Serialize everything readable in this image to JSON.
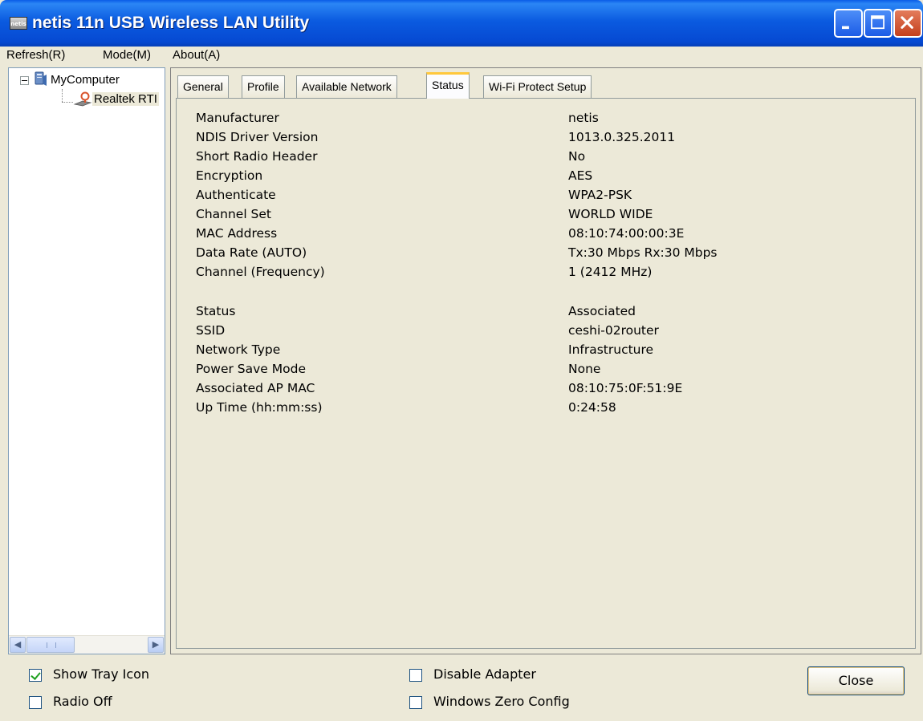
{
  "window": {
    "title": "netis 11n USB Wireless LAN Utility",
    "app_icon": "netis-app-icon",
    "app_icon_text": "netis",
    "controls": [
      "minimize-icon",
      "maximize-icon",
      "close-icon"
    ]
  },
  "menu": {
    "items": [
      {
        "label": "Refresh",
        "mnemonic": "(R)"
      },
      {
        "label": "Mode",
        "mnemonic": "(M)"
      },
      {
        "label": "About",
        "mnemonic": "(A)"
      }
    ]
  },
  "tree": {
    "root": {
      "label": "MyComputer",
      "icon": "computer-icon",
      "expanded": true
    },
    "child": {
      "label": "Realtek RTI",
      "icon": "wireless-adapter-icon",
      "selected": true
    }
  },
  "tabs": [
    {
      "label": "General",
      "active": false
    },
    {
      "label": "Profile",
      "active": false
    },
    {
      "label": "Available Network",
      "active": false
    },
    {
      "label": "Status",
      "active": true
    },
    {
      "label": "Wi-Fi Protect Setup",
      "active": false
    }
  ],
  "status": {
    "adapter_info": [
      {
        "label": "Manufacturer",
        "value": "netis"
      },
      {
        "label": "NDIS Driver Version",
        "value": "1013.0.325.2011"
      },
      {
        "label": "Short Radio Header",
        "value": "No"
      },
      {
        "label": "Encryption",
        "value": "AES"
      },
      {
        "label": "Authenticate",
        "value": "WPA2-PSK"
      },
      {
        "label": "Channel Set",
        "value": "WORLD WIDE"
      },
      {
        "label": "MAC Address",
        "value": "08:10:74:00:00:3E"
      },
      {
        "label": "Data Rate (AUTO)",
        "value": "Tx:30 Mbps Rx:30 Mbps"
      },
      {
        "label": "Channel (Frequency)",
        "value": "1 (2412 MHz)"
      }
    ],
    "connection_info": [
      {
        "label": "Status",
        "value": "Associated"
      },
      {
        "label": "SSID",
        "value": "ceshi-02router"
      },
      {
        "label": "Network Type",
        "value": "Infrastructure"
      },
      {
        "label": "Power Save Mode",
        "value": "None"
      },
      {
        "label": "Associated AP MAC",
        "value": "08:10:75:0F:51:9E"
      },
      {
        "label": "Up Time (hh:mm:ss)",
        "value": "0:24:58"
      }
    ]
  },
  "options": {
    "show_tray_icon": {
      "label": "Show Tray Icon",
      "checked": true
    },
    "radio_off": {
      "label": "Radio Off",
      "checked": false
    },
    "disable_adapter": {
      "label": "Disable Adapter",
      "checked": false
    },
    "windows_zero_config": {
      "label": "Windows Zero Config",
      "checked": false
    }
  },
  "buttons": {
    "close_label": "Close"
  },
  "colors": {
    "titlebar": "#0a5ce8",
    "window_bg": "#ece9d8",
    "active_tab_accent": "#ffc83c",
    "close_button": "#c4401d"
  }
}
